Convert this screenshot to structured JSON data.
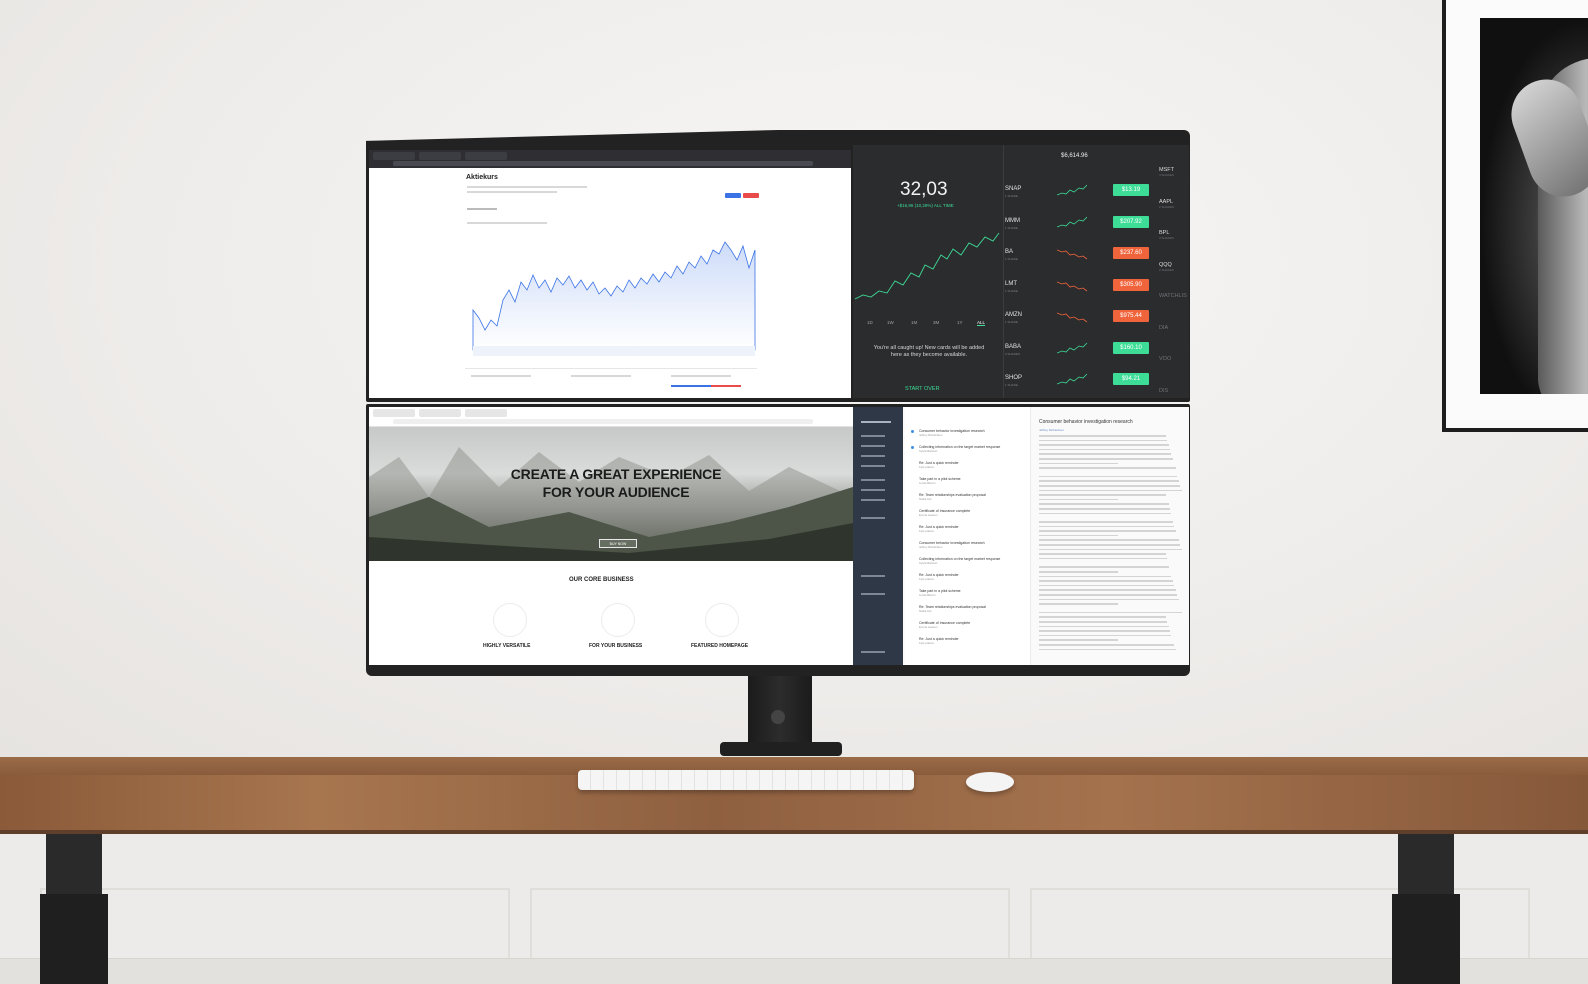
{
  "scene": {
    "description_tags": [
      "curved-ultrawide-monitor",
      "dual-stacked-screens",
      "wooden-desk",
      "framed-cat-photo",
      "keyboard",
      "mouse"
    ]
  },
  "top_left_screen": {
    "page_title": "Aktiekurs",
    "accent_color": "#3b73e6"
  },
  "top_right_screen": {
    "portfolio_value": "32,03",
    "gain_text": "+$16,96 (10,29%) ALL TIME",
    "balance": "$6,614.96",
    "range_tabs": [
      "1D",
      "1W",
      "1M",
      "3M",
      "1Y",
      "ALL"
    ],
    "active_range": "ALL",
    "caught_up_message": "You're all caught up! New cards will be added here as they become available.",
    "start_over": "START OVER",
    "stocks": [
      {
        "symbol": "SNAP",
        "sub": "1 SHARE",
        "price": "$13.19",
        "trend": "up"
      },
      {
        "symbol": "MMM",
        "sub": "1 SHARE",
        "price": "$207.92",
        "trend": "up"
      },
      {
        "symbol": "BA",
        "sub": "1 SHARE",
        "price": "$237.60",
        "trend": "down"
      },
      {
        "symbol": "LMT",
        "sub": "1 SHARE",
        "price": "$305.90",
        "trend": "down"
      },
      {
        "symbol": "AMZN",
        "sub": "1 SHARE",
        "price": "$975.44",
        "trend": "down"
      },
      {
        "symbol": "BABA",
        "sub": "3 SHARES",
        "price": "$160.10",
        "trend": "up"
      },
      {
        "symbol": "SHOP",
        "sub": "1 SHARE",
        "price": "$94.21",
        "trend": "up"
      }
    ],
    "watchlist": [
      {
        "symbol": "MSFT",
        "sub": "4 SHARES"
      },
      {
        "symbol": "AAPL",
        "sub": "2 SHARES"
      },
      {
        "symbol": "BPL",
        "sub": "3 SHARES"
      },
      {
        "symbol": "QQQ",
        "sub": "2 SHARES"
      },
      {
        "symbol": "WATCHLIS",
        "sub": ""
      },
      {
        "symbol": "DIA",
        "sub": ""
      },
      {
        "symbol": "VOO",
        "sub": ""
      },
      {
        "symbol": "DIS",
        "sub": ""
      }
    ],
    "colors": {
      "up": "#3ddc97",
      "down": "#f0643c",
      "background": "#2b2c2e"
    }
  },
  "bottom_left_screen": {
    "hero_title_line1": "CREATE A GREAT EXPERIENCE",
    "hero_title_line2": "FOR YOUR AUDIENCE",
    "buy_button": "BUY NOW",
    "section_title": "OUR CORE BUSINESS",
    "features": [
      "HIGHLY VERSATILE",
      "FOR YOUR BUSINESS",
      "FEATURED HOMEPAGE"
    ]
  },
  "bottom_right_screen": {
    "reader_subject": "Consumer behavior investigation research",
    "reader_author": "Jeffrey Richardson",
    "mail_items": [
      {
        "subject": "Consumer behavior investigation research",
        "from": "Jeffrey Richardson",
        "unread": true
      },
      {
        "subject": "Collecting information on the target market response",
        "from": "Sylvia Bellman",
        "unread": true
      },
      {
        "subject": "Re: Just a quick reminder",
        "from": "Kyle Adams",
        "unread": false
      },
      {
        "subject": "Take part in a pilot scheme",
        "from": "Lucas Barron",
        "unread": false
      },
      {
        "subject": "Re: Team relationships evaluation proposal",
        "from": "Nadia Kim",
        "unread": false
      },
      {
        "subject": "Certificate of Insurance complete",
        "from": "Emma Lawson",
        "unread": false
      },
      {
        "subject": "Re: Just a quick reminder",
        "from": "Kyle Adams",
        "unread": false
      }
    ]
  }
}
